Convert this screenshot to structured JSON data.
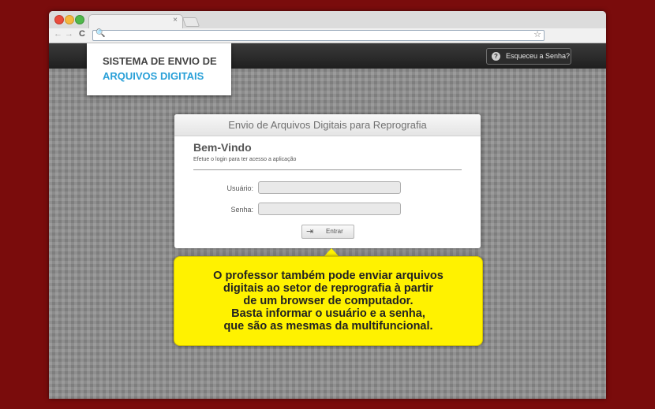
{
  "browser": {
    "tab_close": "×",
    "back_glyph": "←",
    "forward_glyph": "→",
    "reload_glyph": "C",
    "url": "",
    "search_glyph": "🔍",
    "star_glyph": "☆"
  },
  "header": {
    "forgot_label": "Esqueceu a Senha?",
    "forgot_icon": "?"
  },
  "logo": {
    "line1": "SISTEMA DE ENVIO DE",
    "line2": "ARQUIVOS DIGITAIS"
  },
  "login": {
    "title": "Envio de Arquivos Digitais para Reprografia",
    "welcome": "Bem-Vindo",
    "subtitle": "Efetue o login para ter acesso a aplicação",
    "username_label": "Usuário:",
    "username_value": "",
    "password_label": "Senha:",
    "password_value": "",
    "submit_icon": "⇥",
    "submit_label": "Entrar"
  },
  "callout": {
    "text": "O professor também pode enviar arquivos\ndigitais ao setor de reprografia à partir\nde um browser de computador.\nBasta informar o usuário e a senha,\nque são as mesmas da multifuncional."
  },
  "colors": {
    "background": "#7a0c0c",
    "accent_blue": "#2aa0d8",
    "callout_yellow": "#fff200",
    "header_dark": "#2a2a2a"
  }
}
